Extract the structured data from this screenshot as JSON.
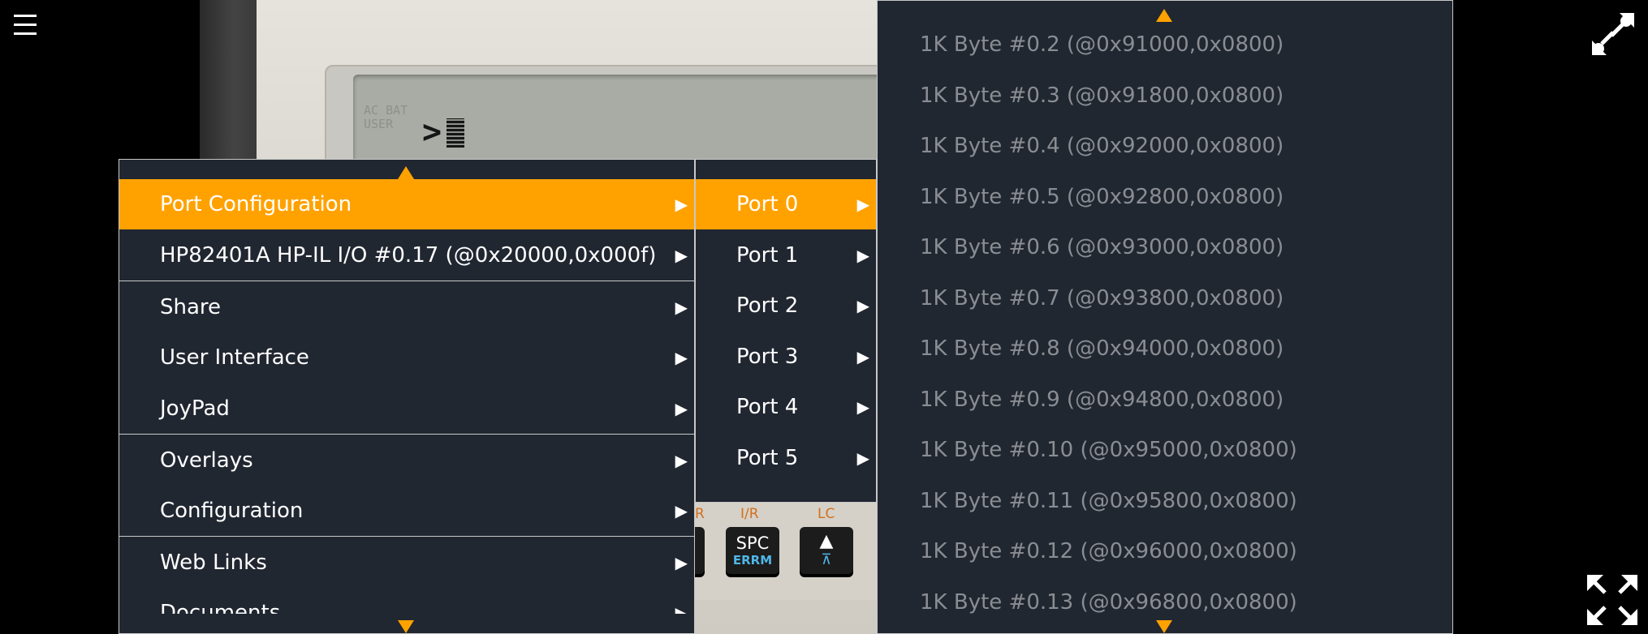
{
  "colors": {
    "accent": "#ffa200",
    "menu_bg": "#212731",
    "menu_border": "#c7c7c7",
    "dim_text": "#8a8d93"
  },
  "icons": {
    "menu": "hamburger-icon",
    "top_right": "collapse-icon",
    "bottom_right": "fullscreen-icon"
  },
  "calculator": {
    "lcd_indicators": "AC BAT\nUSER",
    "lcd_prompt": ">",
    "keys": [
      {
        "top_label": "I/R",
        "main": "SPC",
        "sub": "ERRM"
      },
      {
        "top_label": "LC",
        "main": "▲",
        "sub": "⊼"
      }
    ],
    "partial_label": "R"
  },
  "main_menu": {
    "items": [
      {
        "label": "Port Configuration",
        "arrow": "▶",
        "active": true
      },
      {
        "label": "HP82401A HP-IL I/O #0.17 (@0x20000,0x000f)",
        "arrow": "▶"
      },
      {
        "label": "Share",
        "arrow": "▶"
      },
      {
        "label": "User Interface",
        "arrow": "▶"
      },
      {
        "label": "JoyPad",
        "arrow": "▶"
      },
      {
        "label": "Overlays",
        "arrow": "▶"
      },
      {
        "label": "Configuration",
        "arrow": "▶"
      },
      {
        "label": "Web Links",
        "arrow": "▶"
      },
      {
        "label": "Documents",
        "arrow": "▶"
      }
    ]
  },
  "port_menu": {
    "items": [
      {
        "label": "Port 0",
        "arrow": "▶",
        "active": true
      },
      {
        "label": "Port 1",
        "arrow": "▶"
      },
      {
        "label": "Port 2",
        "arrow": "▶"
      },
      {
        "label": "Port 3",
        "arrow": "▶"
      },
      {
        "label": "Port 4",
        "arrow": "▶"
      },
      {
        "label": "Port 5",
        "arrow": "▶"
      }
    ]
  },
  "module_menu": {
    "items": [
      "1K Byte #0.2 (@0x91000,0x0800)",
      "1K Byte #0.3 (@0x91800,0x0800)",
      "1K Byte #0.4 (@0x92000,0x0800)",
      "1K Byte #0.5 (@0x92800,0x0800)",
      "1K Byte #0.6 (@0x93000,0x0800)",
      "1K Byte #0.7 (@0x93800,0x0800)",
      "1K Byte #0.8 (@0x94000,0x0800)",
      "1K Byte #0.9 (@0x94800,0x0800)",
      "1K Byte #0.10 (@0x95000,0x0800)",
      "1K Byte #0.11 (@0x95800,0x0800)",
      "1K Byte #0.12 (@0x96000,0x0800)",
      "1K Byte #0.13 (@0x96800,0x0800)"
    ]
  }
}
